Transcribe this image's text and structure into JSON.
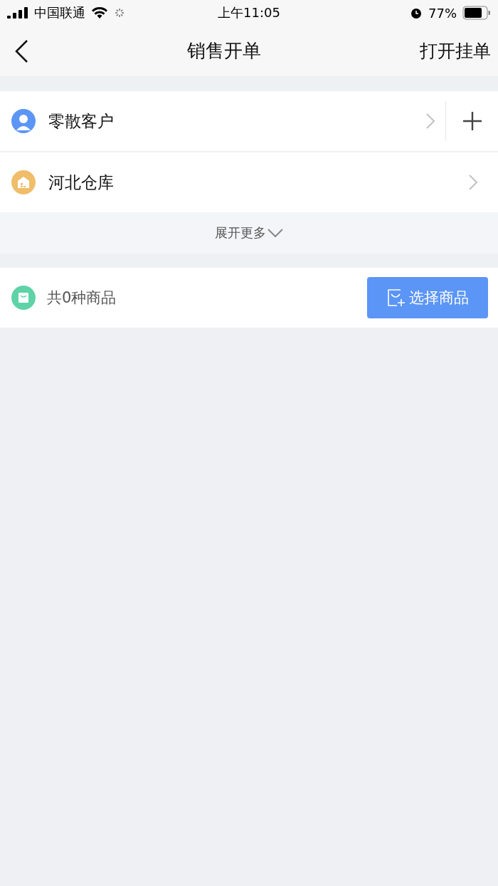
{
  "status_bar": {
    "carrier": "中国联通",
    "time": "上午11:05",
    "battery": "77%"
  },
  "nav": {
    "title": "销售开单",
    "action": "打开挂单"
  },
  "rows": [
    {
      "kind": "customer",
      "label": "零散客户"
    },
    {
      "kind": "warehouse",
      "label": "河北仓库"
    }
  ],
  "expand": {
    "label": "展开更多"
  },
  "goods": {
    "summary": "共0种商品",
    "button": "选择商品"
  }
}
